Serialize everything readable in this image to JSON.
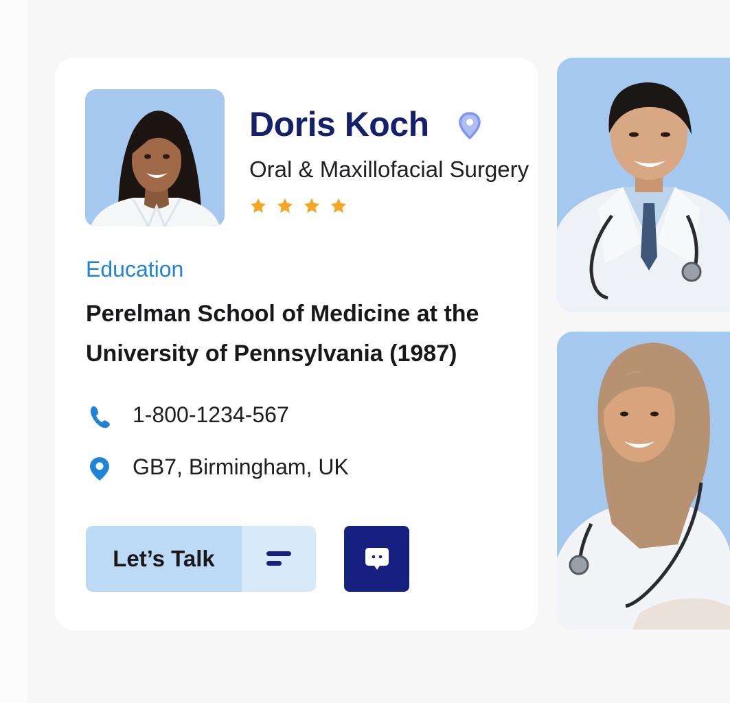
{
  "profile": {
    "name": "Doris Koch",
    "specialty": "Oral & Maxillofacial Surgery",
    "rating": 4,
    "rating_max": 4,
    "education_label": "Education",
    "education": "Perelman School of Medicine at the University of Pennsylvania (1987)",
    "phone": "1-800-1234-567",
    "location": "GB7, Birmingham, UK"
  },
  "actions": {
    "talk_label": "Let’s Talk"
  },
  "icons": {
    "name_location": "map-pin-outline-icon",
    "phone": "phone-icon",
    "address": "map-pin-icon",
    "menu": "menu-lines-icon",
    "chat": "chat-bubble-icon"
  },
  "colors": {
    "brand_navy": "#15207f",
    "accent_blue": "#1f84d6",
    "star": "#f5a623",
    "photo_bg": "#a5c9ee",
    "talk_bg": "#bcdaf5",
    "menu_bg": "#d8e9fa"
  }
}
